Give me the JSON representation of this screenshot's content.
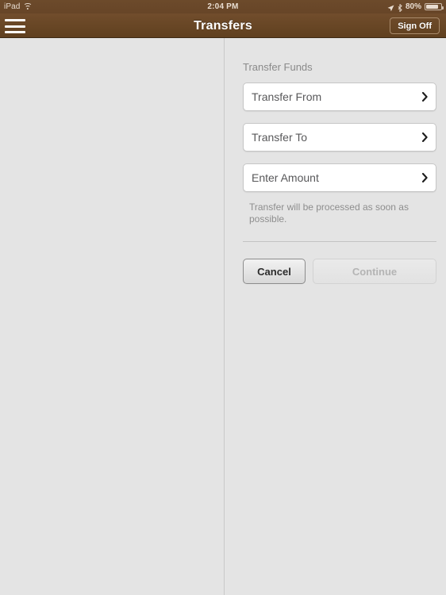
{
  "status_bar": {
    "device_label": "iPad",
    "wifi_icon": "wifi-icon",
    "time": "2:04 PM",
    "location_icon": "location-arrow-icon",
    "bluetooth_icon": "bluetooth-icon",
    "battery_percent": "80%",
    "battery_icon": "battery-icon"
  },
  "nav_bar": {
    "menu_icon": "hamburger-menu-icon",
    "title": "Transfers",
    "sign_off_label": "Sign Off"
  },
  "main": {
    "section_title": "Transfer Funds",
    "fields": [
      {
        "label": "Transfer From",
        "chevron_icon": "chevron-right-icon"
      },
      {
        "label": "Transfer To",
        "chevron_icon": "chevron-right-icon"
      },
      {
        "label": "Enter Amount",
        "chevron_icon": "chevron-right-icon"
      }
    ],
    "helper_text": "Transfer will be processed as soon as possible.",
    "buttons": {
      "cancel_label": "Cancel",
      "continue_label": "Continue",
      "continue_disabled": true
    }
  },
  "colors": {
    "nav_brown_top": "#714d2c",
    "nav_brown_bottom": "#60401f",
    "status_brown": "#6c4a2b",
    "page_background": "#e4e4e4",
    "field_background": "#ffffff",
    "field_border": "#c6c6c6",
    "label_gray": "#8a8a8a",
    "text_dark": "#58585a",
    "disabled_text": "#b4b4b4"
  }
}
